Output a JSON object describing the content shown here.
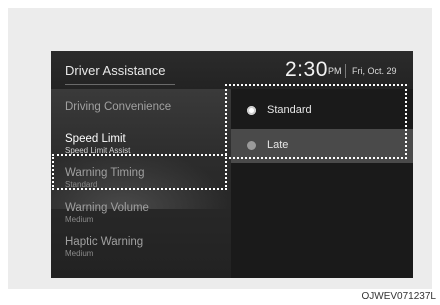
{
  "header": {
    "title": "Driver Assistance",
    "time": "2:30",
    "ampm": "PM",
    "date": "Fri, Oct. 29"
  },
  "menu": {
    "items": [
      {
        "label": "Driving Convenience",
        "sub": ""
      },
      {
        "label": "Speed Limit",
        "sub": "Speed Limit Assist"
      },
      {
        "label": "Warning Timing",
        "sub": "Standard"
      },
      {
        "label": "Warning Volume",
        "sub": "Medium"
      },
      {
        "label": "Haptic Warning",
        "sub": "Medium"
      }
    ],
    "selected_index": 2
  },
  "options": {
    "items": [
      {
        "label": "Standard",
        "selected": true
      },
      {
        "label": "Late",
        "selected": false
      }
    ]
  },
  "figure_code": "OJWEV071237L"
}
